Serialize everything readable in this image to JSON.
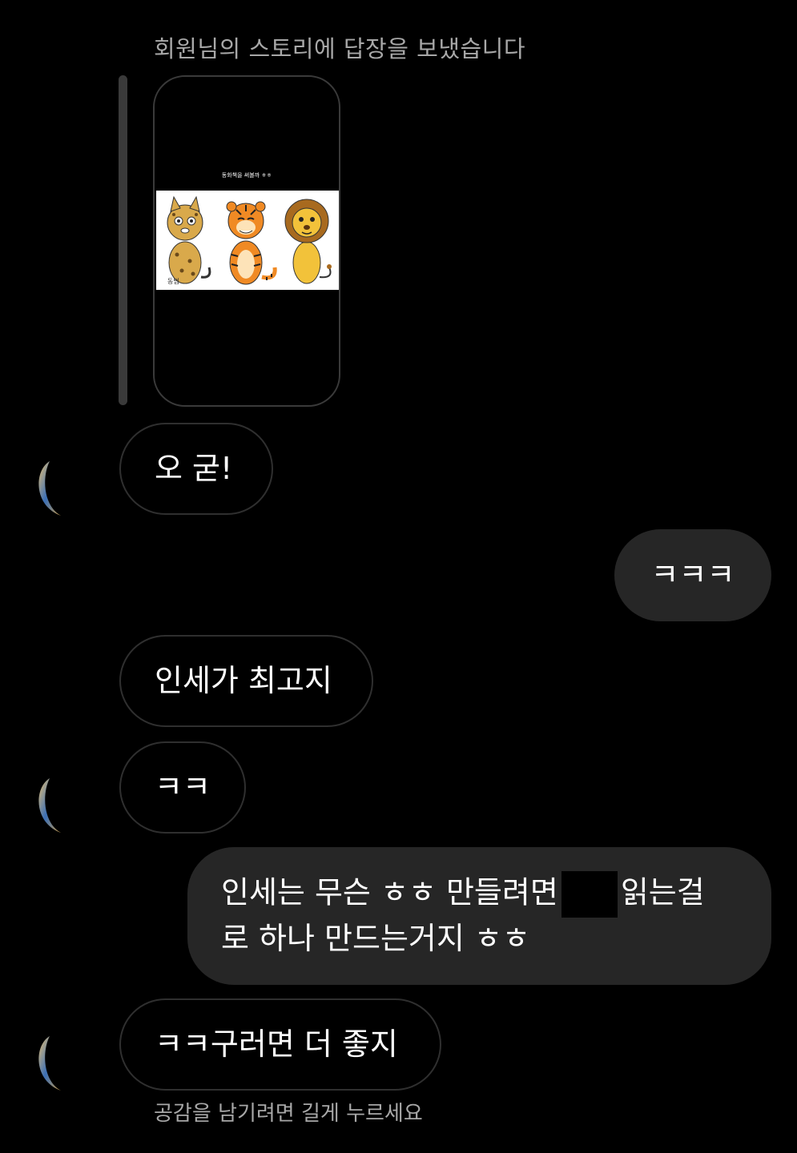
{
  "reply_header": "회원님의 스토리에 답장을 보냈습니다",
  "story": {
    "caption": "동화책을 써볼까 ㅎㅎ",
    "signature": "동범"
  },
  "messages": [
    {
      "from": "them",
      "text": "오 굳!"
    },
    {
      "from": "me",
      "text": "ㅋㅋㅋ"
    },
    {
      "from": "them",
      "text": "인세가 최고지"
    },
    {
      "from": "them",
      "text": "ㅋㅋ"
    },
    {
      "from": "me",
      "line1_before": "인세는 무슨 ㅎㅎ 만들려면",
      "line1_after": "읽는걸",
      "line2": "로 하나 만드는거지 ㅎㅎ"
    },
    {
      "from": "them",
      "text": "ㅋㅋ구러면 더 좋지"
    }
  ],
  "footer_hint": "공감을 남기려면 길게 누르세요",
  "colors": {
    "background": "#000000",
    "incoming_border": "#2f2f2f",
    "outgoing_bubble": "#262626",
    "secondary_text": "#a8a8a8"
  }
}
